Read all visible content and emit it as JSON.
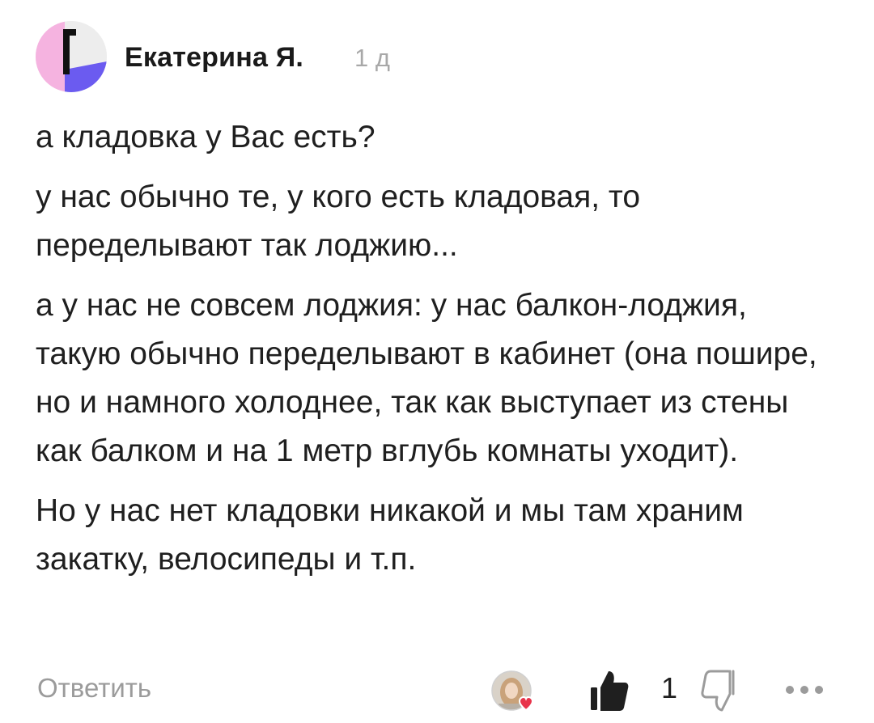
{
  "comment": {
    "author": "Екатерина Я.",
    "time": "1 д",
    "paragraphs": [
      "а кладовка у Вас есть?",
      "у нас обычно те, у кого есть кладовая, то переделывают так лоджию...",
      "а у нас не совсем лоджия: у нас балкон-лоджия, такую обычно переделывают в кабинет (она пошире, но и намного холоднее, так как выступает из стены как балком и на 1 метр вглубь комнаты уходит).",
      "Но у нас нет кладовки никакой и мы там храним закатку, велосипеды и т.п."
    ]
  },
  "actions": {
    "reply_label": "Ответить",
    "like_count": "1"
  },
  "icons": {
    "avatar": "author-avatar",
    "liker": "liker-avatar",
    "like": "thumbs-up-icon",
    "dislike": "thumbs-down-icon",
    "more": "more-dots-icon"
  },
  "colors": {
    "avatar_pink": "#f5b3e0",
    "avatar_purple": "#6b5bf0",
    "muted": "#9b9b9b",
    "text": "#1f1f1f",
    "heart": "#e8334a"
  }
}
